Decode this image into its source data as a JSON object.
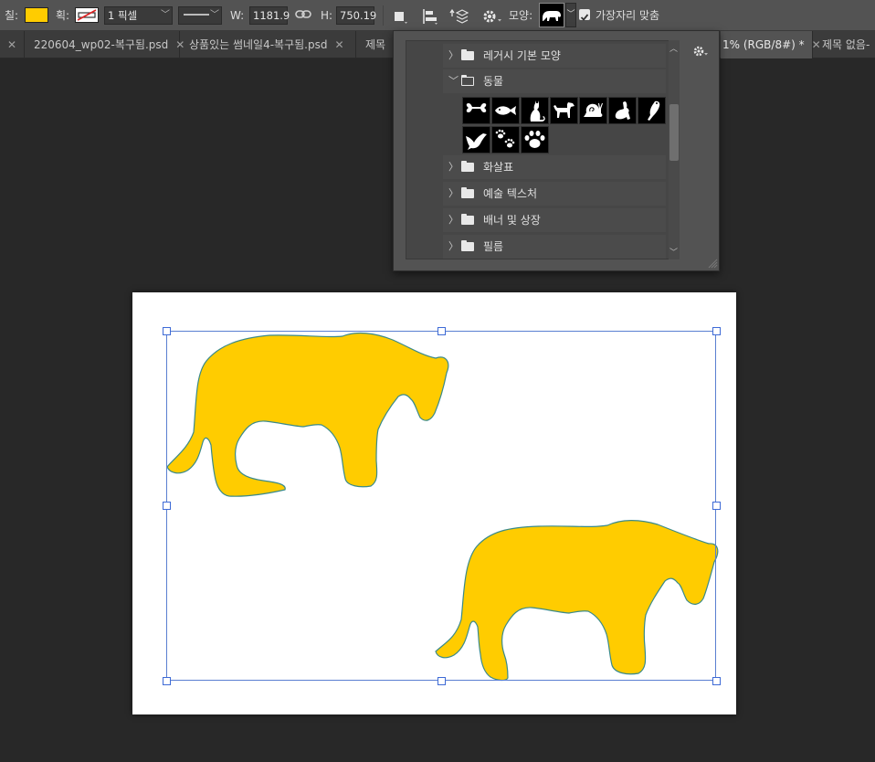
{
  "options_bar": {
    "fill_label": "칠:",
    "fill_color": "#ffcc00",
    "stroke_label": "획:",
    "stroke_width": "1 픽셀",
    "width_label": "W:",
    "width_value": "1181.9",
    "height_label": "H:",
    "height_value": "750.19",
    "shape_label": "모양:",
    "align_edges_label": "가장자리 맞춤",
    "align_edges_checked": true
  },
  "tabs": [
    {
      "label": "220604_wp02-복구됨.psd",
      "active": false
    },
    {
      "label": "상품있는 썸네일4-복구됨.psd",
      "active": false
    },
    {
      "label": "제목 ",
      "active": false
    },
    {
      "label": "1% (RGB/8#) *",
      "active": true
    },
    {
      "label": "제목 없음-",
      "active": false
    }
  ],
  "shape_picker": {
    "groups": [
      {
        "label": "레거시 기본 모양",
        "expanded": false
      },
      {
        "label": "동물",
        "expanded": true
      },
      {
        "label": "화살표",
        "expanded": false
      },
      {
        "label": "예술 텍스처",
        "expanded": false
      },
      {
        "label": "배너 및 상장",
        "expanded": false
      },
      {
        "label": "필름",
        "expanded": false
      }
    ],
    "animal_shapes": [
      "bone-icon",
      "fish-icon",
      "cat-icon",
      "dog-icon",
      "snail-icon",
      "rabbit-icon",
      "parrot-icon",
      "bird-icon",
      "paw-prints-icon",
      "paw-icon"
    ]
  },
  "canvas": {
    "background": "#ffffff",
    "shape_fill": "#ffcc00",
    "shape_stroke": "#3a8a8a"
  }
}
